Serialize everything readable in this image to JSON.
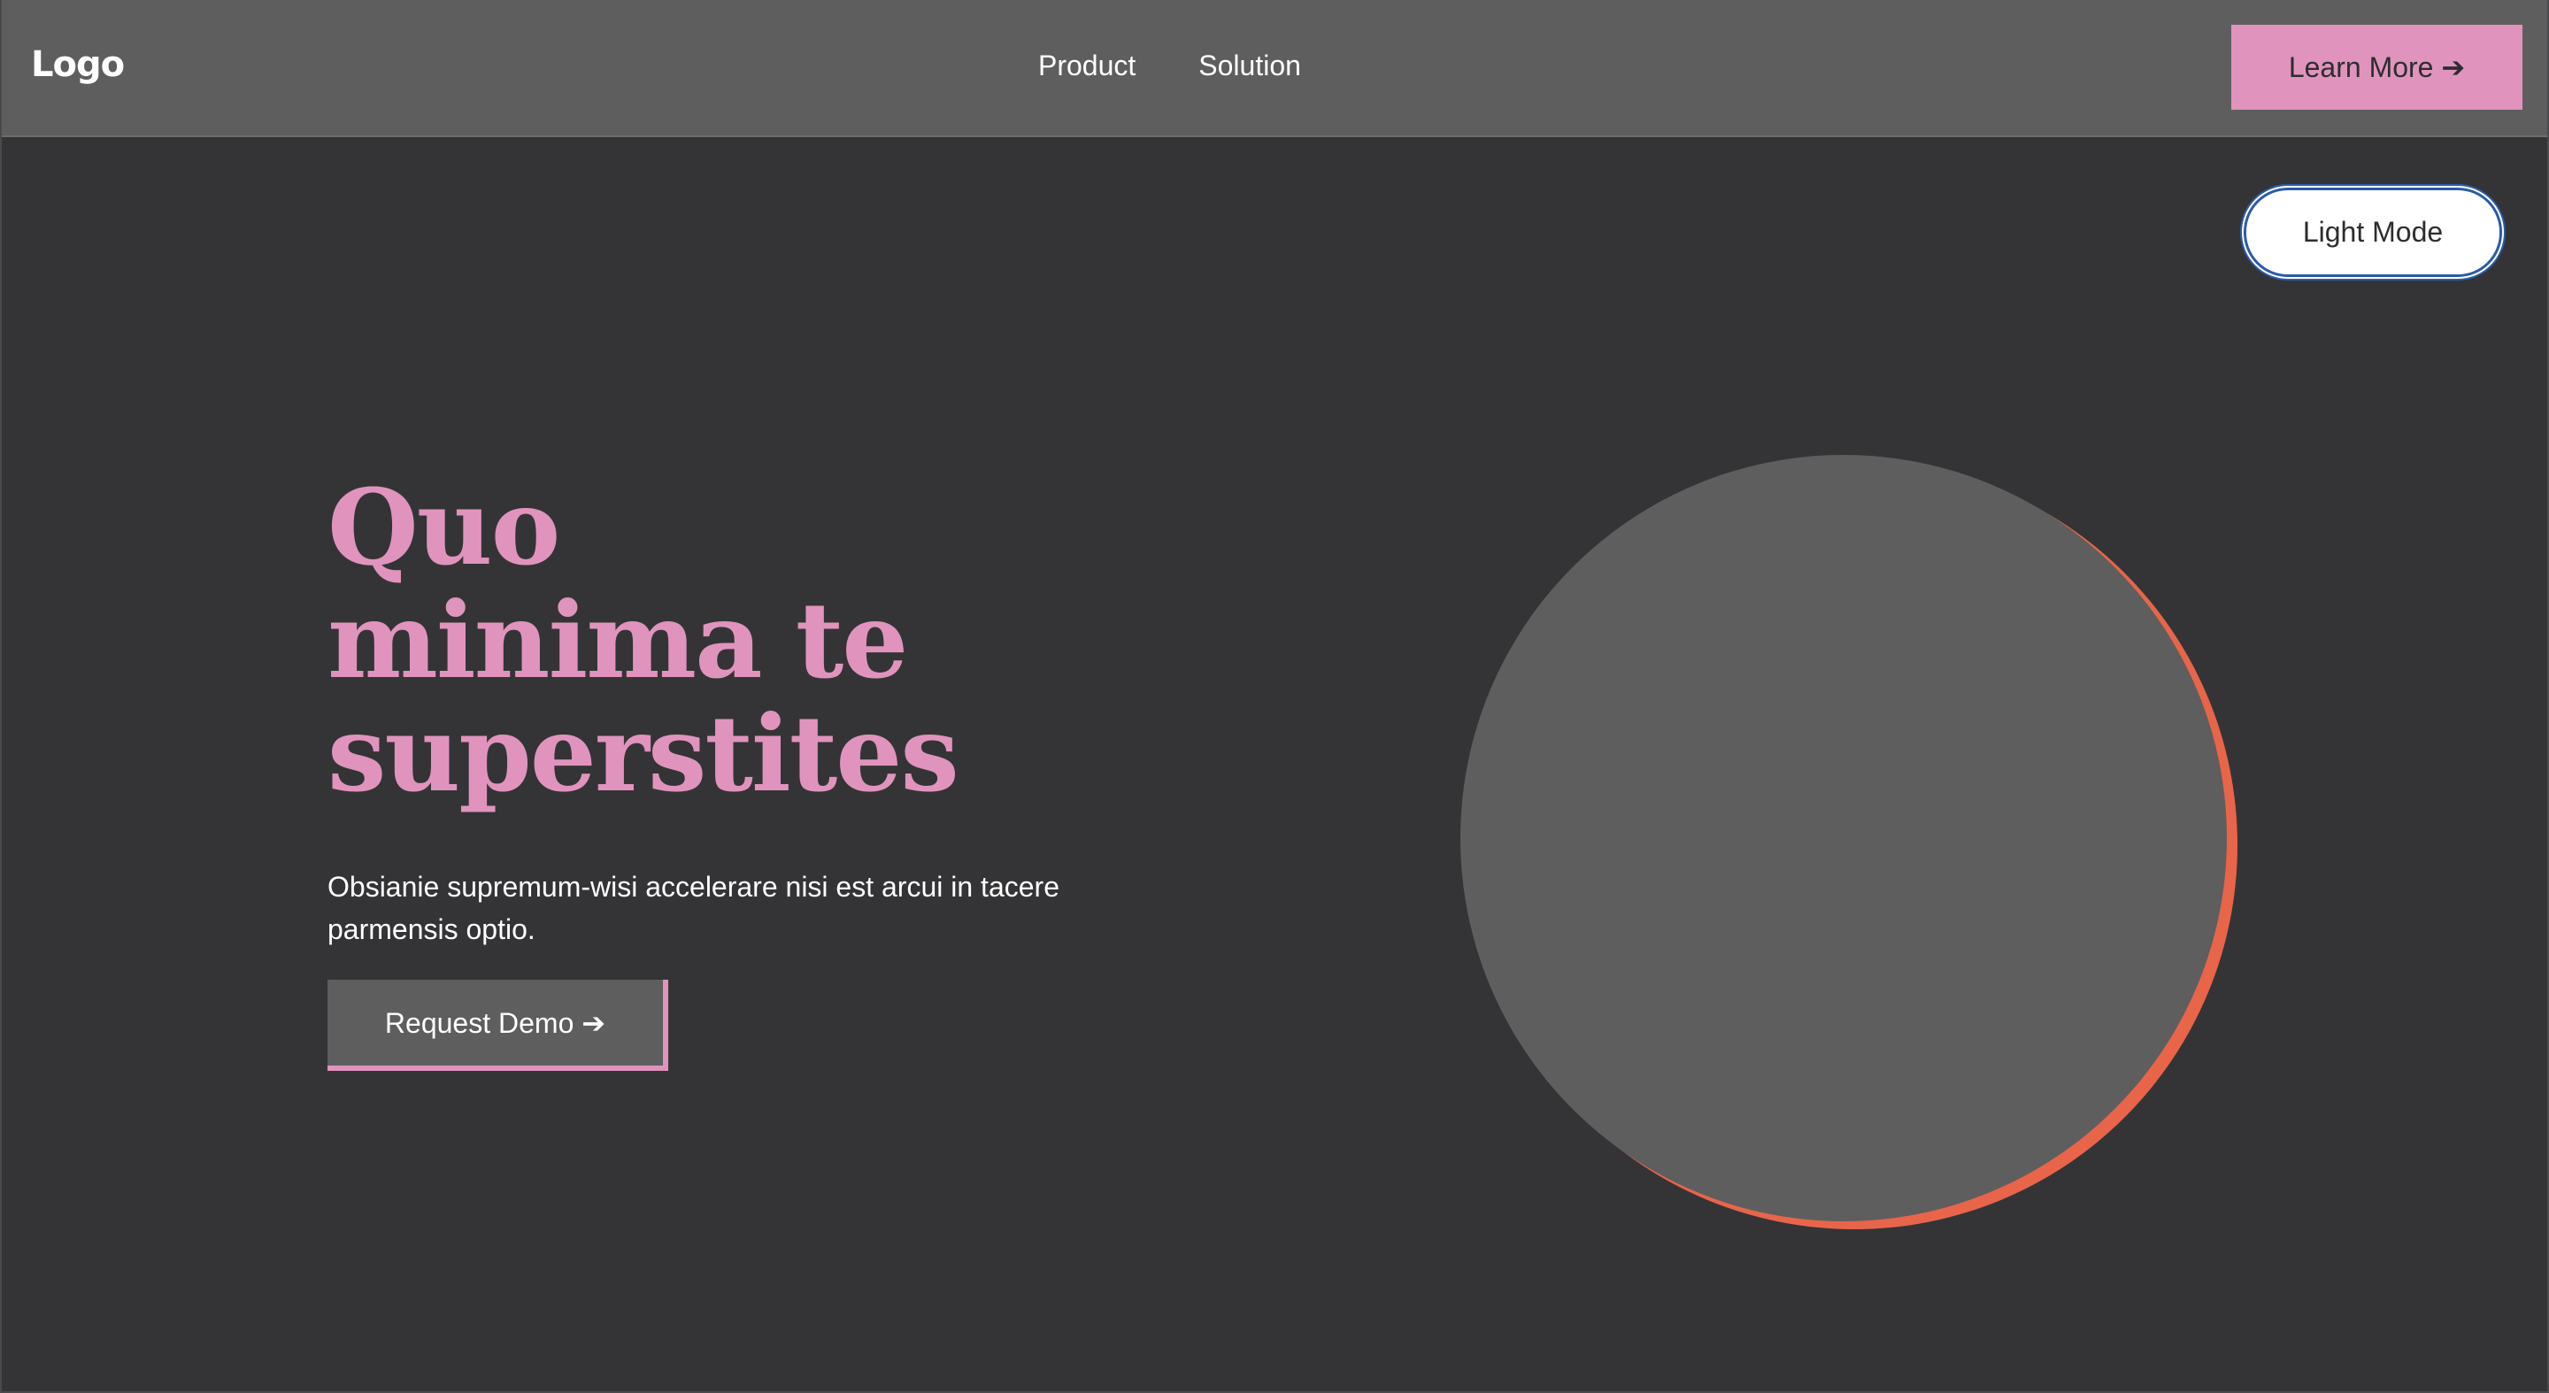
{
  "header": {
    "logo": "Logo",
    "nav": [
      {
        "label": "Product"
      },
      {
        "label": "Solution"
      }
    ],
    "cta_label": "Learn More ➔"
  },
  "theme_toggle": {
    "label": "Light Mode"
  },
  "hero": {
    "title_lines": [
      "Quo",
      "minima te",
      "superstites"
    ],
    "subtitle": "Obsianie supremum-wisi accelerare nisi est arcui in tacere parmensis optio.",
    "cta_label": "Request Demo ➔"
  },
  "colors": {
    "background": "#343436",
    "header_bg": "#5e5e5e",
    "accent_pink": "#e094bd",
    "accent_orange": "#e8654a",
    "circle_fill": "#5e5e5e",
    "toggle_border": "#2b5ba8"
  }
}
